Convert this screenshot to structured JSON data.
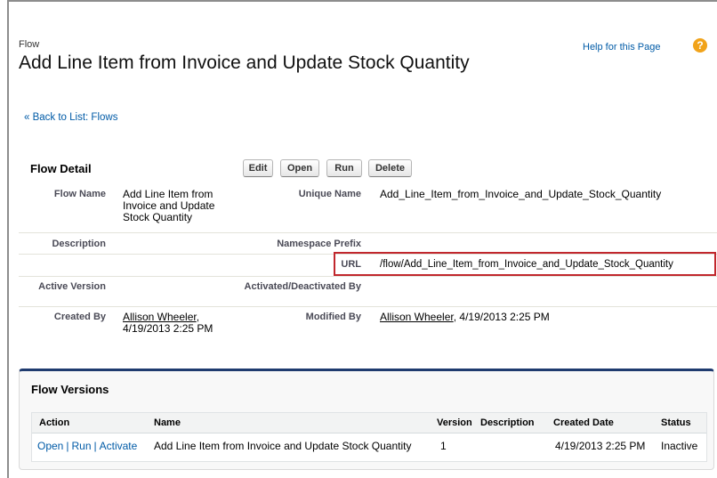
{
  "header": {
    "type_label": "Flow",
    "title": "Add Line Item from Invoice and Update Stock Quantity",
    "help_link": "Help for this Page",
    "help_icon": "?"
  },
  "back_link": "« Back to List: Flows",
  "detail": {
    "section_title": "Flow Detail",
    "buttons": {
      "edit": "Edit",
      "open": "Open",
      "run": "Run",
      "delete": "Delete"
    },
    "fields": {
      "flow_name_label": "Flow Name",
      "flow_name_value": "Add Line Item from Invoice and Update Stock Quantity",
      "unique_name_label": "Unique Name",
      "unique_name_value": "Add_Line_Item_from_Invoice_and_Update_Stock_Quantity",
      "description_label": "Description",
      "description_value": "",
      "namespace_prefix_label": "Namespace Prefix",
      "namespace_prefix_value": "",
      "url_label": "URL",
      "url_value": "/flow/Add_Line_Item_from_Invoice_and_Update_Stock_Quantity",
      "active_version_label": "Active Version",
      "active_version_value": "",
      "activated_label": "Activated/Deactivated By",
      "activated_value": "",
      "created_by_label": "Created By",
      "created_by_user": "Allison Wheeler",
      "created_by_date": "4/19/2013 2:25 PM",
      "modified_by_label": "Modified By",
      "modified_by_user": "Allison Wheeler",
      "modified_by_date": "4/19/2013 2:25 PM"
    }
  },
  "versions": {
    "section_title": "Flow Versions",
    "columns": [
      "Action",
      "Name",
      "Version",
      "Description",
      "Created Date",
      "Status"
    ],
    "rows": [
      {
        "actions": [
          "Open",
          "Run",
          "Activate"
        ],
        "separator": "|",
        "name": "Add Line Item from Invoice and Update Stock Quantity",
        "version": "1",
        "description": "",
        "created_date": "4/19/2013 2:25 PM",
        "status": "Inactive"
      }
    ]
  },
  "colors": {
    "link": "#015ba7",
    "highlight_border": "#c1272d",
    "section_accent": "#1f3b6f",
    "help_icon": "#f1a31a"
  }
}
